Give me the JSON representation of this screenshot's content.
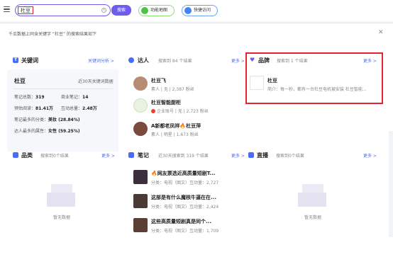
{
  "search": {
    "query": "杜豆",
    "button": "搜索",
    "clear": "×"
  },
  "pills": {
    "map": "功能地图",
    "quick": "快捷访问"
  },
  "result_header": "千瓜数据上同含关键字 “杜豆” 的搜索结果如下",
  "keyword": {
    "title": "关键词",
    "more": "关键词分析 >",
    "word": "杜豆",
    "range": "近30天关键词数据",
    "stats": [
      {
        "label": "笔记总数：",
        "value": "319",
        "label2": "商业笔记：",
        "value2": "14"
      },
      {
        "label": "预估阅读：",
        "value": "81.41万",
        "label2": "互动总量：",
        "value2": "2.48万"
      }
    ],
    "category_label": "笔记最多的分类：",
    "category_value": "美妆 (28.84%)",
    "attr_label": "达人最多的属性：",
    "attr_value": "女性 (59.25%)"
  },
  "talent": {
    "title": "达人",
    "sub": "搜索到 84 个结果",
    "more": "更多 >",
    "items": [
      {
        "name": "杜豆飞",
        "meta": "素人 | 无 | 2,387 粉丝"
      },
      {
        "name": "杜豆智能厨柜",
        "meta": "企业账号 | 无 | 2,723 粉丝"
      },
      {
        "name": "A新都老凤祥🔥杜豆萍",
        "meta": "素人 | 明星 | 1,673 粉丝"
      }
    ]
  },
  "brand": {
    "title": "品牌",
    "sub": "搜索到 1 个结果",
    "more": "更多 >",
    "name": "杜豆",
    "desc": "简介：每一秒，都有一台杜豆电机被安装 杜豆智能..."
  },
  "category": {
    "title": "品类",
    "sub": "搜索到0个结果",
    "more": "更多 >",
    "empty": "暂无数据"
  },
  "notes": {
    "title": "笔记",
    "sub": "近30天搜索到 319 个结果",
    "more": "更多 >",
    "items": [
      {
        "title": "🔥网友票选近高质量短剧T...",
        "cat_label": "分类：",
        "cat": "电视（图文）",
        "int_label": "互动量：",
        "int": "2,727"
      },
      {
        "title": "这部是有什么魔核牛逼在在...",
        "cat_label": "分类：",
        "cat": "电视（图文）",
        "int_label": "互动量：",
        "int": "2,424"
      },
      {
        "title": "这些高质量短剧真是同个...",
        "cat_label": "分类：",
        "cat": "电视（图文）",
        "int_label": "互动量：",
        "int": "1,709"
      }
    ]
  },
  "live": {
    "title": "直播",
    "sub": "搜索到0个结果",
    "more": "更多 >",
    "empty": "暂无数据"
  },
  "colors": {
    "accent": "#6e5cf0",
    "highlight": "#e0262e",
    "link": "#4a6cf7"
  },
  "icons": {
    "menu": "menu-icon",
    "close": "close-icon",
    "keyword": "keyword-icon",
    "talent": "talent-icon",
    "brand": "brand-heart-icon",
    "category": "grid-icon",
    "notes": "note-icon",
    "live": "live-camera-icon"
  }
}
